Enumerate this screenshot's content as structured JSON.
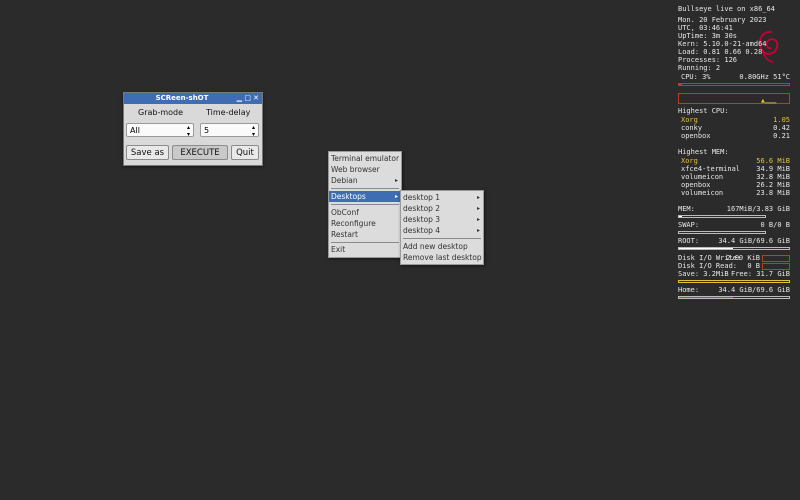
{
  "screenshot_tool": {
    "title": "SCReen-shOT",
    "controls": {
      "minimize": "▁",
      "maximize": "□",
      "close": "✕"
    },
    "grab_mode_label": "Grab-mode",
    "time_delay_label": "Time-delay",
    "grab_mode_value": "All",
    "time_delay_value": "5",
    "save_as_label": "Save as",
    "execute_label": "EXECUTE",
    "quit_label": "Quit"
  },
  "root_menu": {
    "items": [
      {
        "label": "Terminal emulator"
      },
      {
        "label": "Web browser"
      },
      {
        "label": "Debian",
        "submenu": true
      },
      {
        "label": "Desktops",
        "submenu": true,
        "active": true
      },
      {
        "label": "ObConf"
      },
      {
        "label": "Reconfigure"
      },
      {
        "label": "Restart"
      },
      {
        "label": "Exit"
      }
    ],
    "submenu_arrow": "▸"
  },
  "desktops_menu": {
    "items": [
      {
        "label": "desktop 1",
        "submenu": true
      },
      {
        "label": "desktop 2",
        "submenu": true
      },
      {
        "label": "desktop 3",
        "submenu": true
      },
      {
        "label": "desktop 4",
        "submenu": true
      },
      {
        "label": "Add new desktop"
      },
      {
        "label": "Remove last desktop"
      }
    ]
  },
  "conky": {
    "header": "Bullseye live on x86_64",
    "date": "Mon.  20 February 2023",
    "time": "UTC,    03:46:41",
    "uptime": "UpTime: 3m 30s",
    "kernel": "Kern: 5.10.0-21-amd64",
    "load": "Load: 0.81 0.66 0.28",
    "processes": "Processes: 126",
    "running": "Running:  2",
    "cpu_label": "CPU: 3%",
    "cpu_freq": "0.80GHz  51°C",
    "cpu_percent": 3,
    "highest_cpu_title": "Highest CPU:",
    "highest_cpu": [
      {
        "name": "Xorg",
        "value": "1.05",
        "highlight": true
      },
      {
        "name": "conky",
        "value": "0.42"
      },
      {
        "name": "openbox",
        "value": "0.21"
      }
    ],
    "highest_mem_title": "Highest MEM:",
    "highest_mem": [
      {
        "name": "Xorg",
        "value": "56.6 MiB",
        "highlight": true
      },
      {
        "name": "xfce4-terminal",
        "value": "34.9 MiB"
      },
      {
        "name": "volumeicon",
        "value": "32.8 MiB"
      },
      {
        "name": "openbox",
        "value": "26.2 MiB"
      },
      {
        "name": "volumeicon",
        "value": "23.8 MiB"
      }
    ],
    "mem_label": "MEM:",
    "mem_value": "167MiB/3.83 GiB",
    "mem_percent": 4,
    "swap_label": "SWAP:",
    "swap_value": "0 B/0 B",
    "swap_percent": 0,
    "root_label": "ROOT:",
    "root_value": "34.4 GiB/69.6 GiB",
    "root_percent": 49,
    "disk_write_label": "Disk I/O Write:",
    "disk_write_value": "2.00 KiB",
    "disk_read_label": "Disk I/O Read:",
    "disk_read_value": "0 B",
    "save_label": "Save: 3.2MiB",
    "free_label": "Free:  31.7 GiB",
    "home_label": "Home:",
    "home_value": "34.4 GiB/69.6 GiB",
    "home_percent": 49,
    "colors": {
      "accent": "#e2c23a",
      "cpu_bar": "#c0392b",
      "mem_bar": "#ffffff",
      "home_bar": "#2e8b2e",
      "debian_red": "#c70036"
    }
  }
}
